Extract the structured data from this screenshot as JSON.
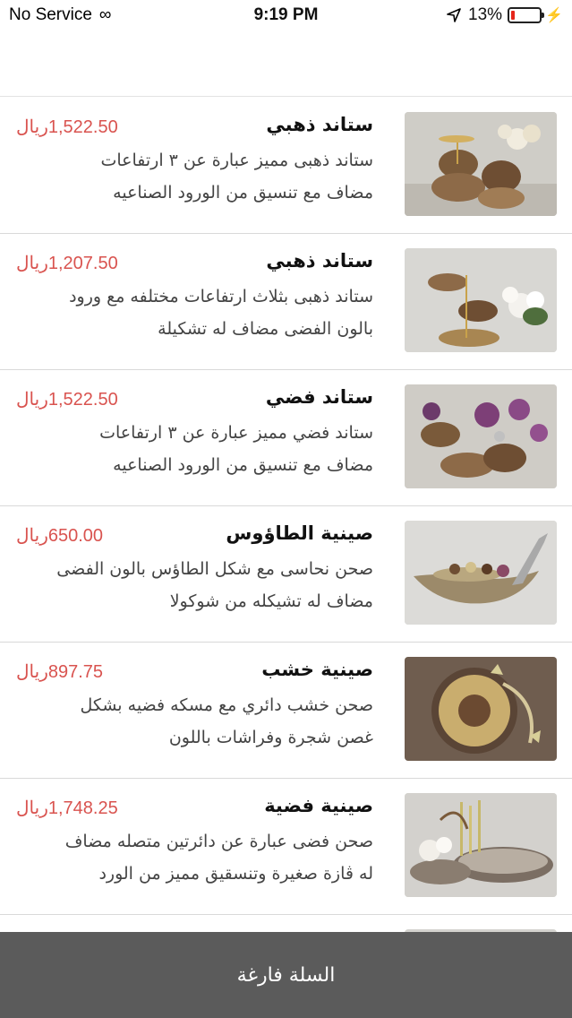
{
  "status_bar": {
    "carrier": "No Service",
    "time": "9:19 PM",
    "battery_percent": "13%",
    "battery_level": 0.13,
    "battery_color": "#e5261b"
  },
  "products": [
    {
      "title": "ستاند ذهبي",
      "price": "1,522.50ريال",
      "description": "ستاند ذهبى مميز عبارة عن ٣ ارتفاعات مضاف مع تنسيق من الورود الصناعيه",
      "image": "gold-stand-photo"
    },
    {
      "title": "ستاند ذهبي",
      "price": "1,207.50ريال",
      "description": "ستاند ذهبى بثلاث ارتفاعات مختلفه مع ورود بالون الفضى مضاف له تشكيلة",
      "image": "gold-stand-orchid-photo"
    },
    {
      "title": "ستاند فضي",
      "price": "1,522.50ريال",
      "description": "ستاند فضي مميز عبارة عن ٣ ارتفاعات مضاف مع تنسيق من الورود الصناعيه",
      "image": "silver-stand-photo"
    },
    {
      "title": "صينية الطاؤوس",
      "price": "650.00ريال",
      "description": "صحن نحاسى مع شكل الطاؤس بالون الفضى مضاف له تشيكله من شوكولا",
      "image": "peacock-tray-photo"
    },
    {
      "title": "صينية خشب",
      "price": "897.75ريال",
      "description": "صحن خشب دائري مع مسكه فضيه بشكل غصن شجرة وفراشات باللون",
      "image": "wood-tray-photo"
    },
    {
      "title": "صينية فضية",
      "price": "1,748.25ريال",
      "description": "صحن فضى عبارة عن دائرتين متصله مضاف له ڤازة صغيرة وتنسقيق مميز من الورد",
      "image": "silver-tray-photo"
    }
  ],
  "cart": {
    "label": "السلة فارغة"
  },
  "colors": {
    "price": "#d9534f",
    "cart_bar": "#5b5b5b"
  }
}
